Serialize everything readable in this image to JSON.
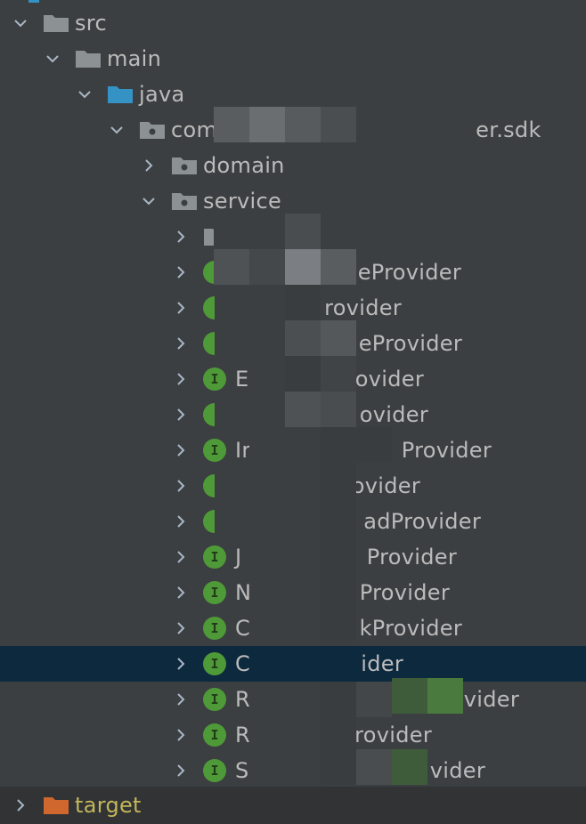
{
  "tree": {
    "src": "src",
    "main": "main",
    "java": "java",
    "package_prefix": "com",
    "package_suffix": "er.sdk",
    "domain": "domain",
    "service": "service",
    "items": [
      {
        "prefix": "",
        "suffix": "",
        "icon": "package-icon"
      },
      {
        "prefix": "",
        "suffix": "eProvider",
        "icon": "interface-icon"
      },
      {
        "prefix": "",
        "suffix": "rovider",
        "icon": "interface-icon"
      },
      {
        "prefix": "",
        "suffix": "eProvider",
        "icon": "interface-icon"
      },
      {
        "prefix": "E",
        "suffix": "ovider",
        "icon": "interface-icon"
      },
      {
        "prefix": "",
        "suffix": "ovider",
        "icon": "interface-icon"
      },
      {
        "prefix": "Ir",
        "suffix": "Provider",
        "icon": "interface-icon"
      },
      {
        "prefix": "",
        "suffix": "ovider",
        "icon": "interface-icon"
      },
      {
        "prefix": "",
        "suffix": "adProvider",
        "icon": "interface-icon"
      },
      {
        "prefix": "J",
        "suffix": "Provider",
        "icon": "interface-icon"
      },
      {
        "prefix": "N",
        "suffix": "Provider",
        "icon": "interface-icon"
      },
      {
        "prefix": "C",
        "suffix": "kProvider",
        "icon": "interface-icon"
      },
      {
        "prefix": "C",
        "suffix": "ider",
        "icon": "interface-icon"
      },
      {
        "prefix": "R",
        "suffix": "vider",
        "icon": "interface-icon"
      },
      {
        "prefix": "R",
        "suffix": "rovider",
        "icon": "interface-icon"
      },
      {
        "prefix": "S",
        "suffix": "vider",
        "icon": "interface-icon"
      }
    ],
    "interface_letter": "I",
    "target": "target"
  },
  "colors": {
    "background": "#3c3f41",
    "selected_row": "#0d293e",
    "interface_badge": "#4f9a38",
    "target_folder": "#c3b65a",
    "java_folder": "#3592c4"
  }
}
